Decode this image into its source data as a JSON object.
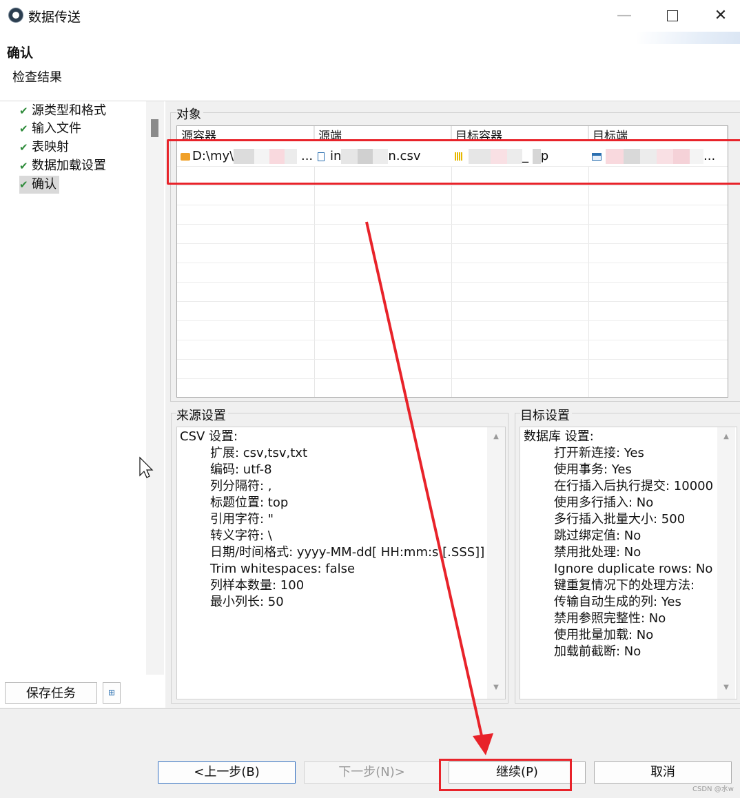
{
  "window": {
    "title": "数据传送"
  },
  "header": {
    "title": "确认",
    "subtitle": "检查结果"
  },
  "sidebar": {
    "steps": [
      {
        "label": "源类型和格式"
      },
      {
        "label": "输入文件"
      },
      {
        "label": "表映射"
      },
      {
        "label": "数据加载设置"
      },
      {
        "label": "确认"
      }
    ],
    "save_task_label": "保存任务"
  },
  "objects": {
    "section_label": "对象",
    "columns": [
      "源容器",
      "源端",
      "目标容器",
      "目标端"
    ],
    "rows": [
      {
        "source_container": "D:\\my\\",
        "source_container_tail": "...",
        "source": "in",
        "source_tail": "n.csv",
        "target_container_tail": "_ ",
        "target_container_end": "p",
        "target_tail": "..."
      }
    ]
  },
  "source_settings": {
    "label": "来源设置",
    "heading": "CSV 设置:",
    "lines": [
      "扩展: csv,tsv,txt",
      "编码: utf-8",
      "列分隔符: ,",
      "标题位置: top",
      "引用字符: \"",
      "转义字符: \\",
      "日期/时间格式: yyyy-MM-dd[ HH:mm:s [.SSS]]",
      "Trim whitespaces: false",
      "列样本数量: 100",
      "最小列长: 50"
    ]
  },
  "target_settings": {
    "label": "目标设置",
    "heading": "数据库 设置:",
    "lines": [
      "打开新连接: Yes",
      "使用事务: Yes",
      "在行插入后执行提交: 10000",
      "使用多行插入: No",
      "多行插入批量大小: 500",
      "跳过绑定值: No",
      "禁用批处理: No",
      "Ignore duplicate rows: No",
      "键重复情况下的处理方法:",
      "传输自动生成的列: Yes",
      "禁用参照完整性: No",
      "使用批量加载: No",
      "加载前截断: No"
    ]
  },
  "buttons": {
    "back": "<上一步(B)",
    "next": "下一步(N)>",
    "continue": "继续(P)",
    "cancel": "取消"
  },
  "watermark": "CSDN @水w",
  "colors": {
    "annotation_red": "#e8232a",
    "check_green": "#2e8b3a",
    "accent_blue": "#2d6cc0"
  },
  "icons": {
    "title": "app-logo-icon",
    "steps": "check-icon",
    "row": [
      "folder-icon",
      "csv-file-icon",
      "database-icon",
      "table-icon"
    ]
  }
}
